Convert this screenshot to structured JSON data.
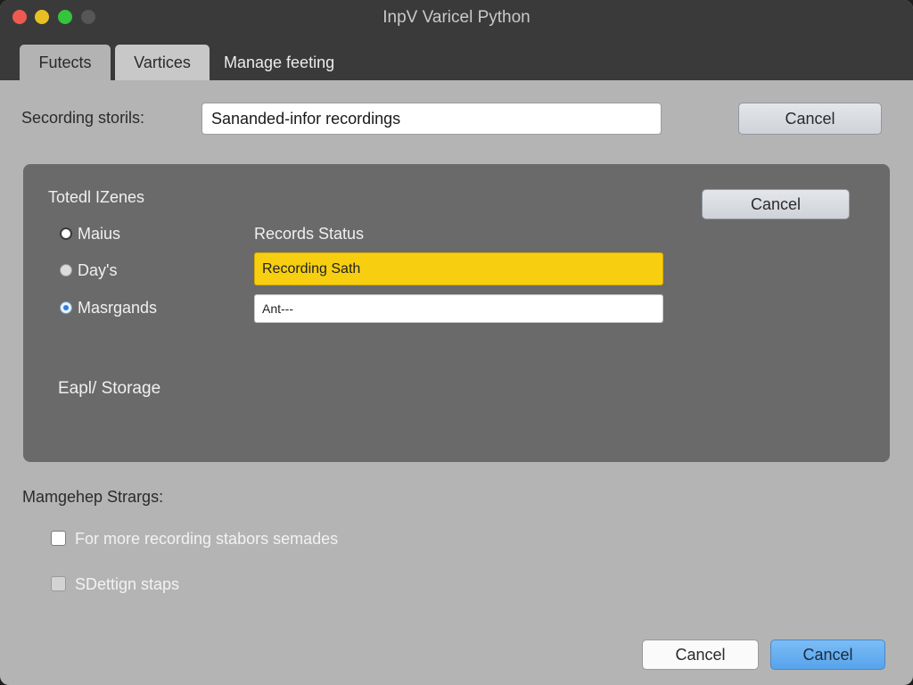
{
  "window": {
    "title": "InpV Varicel Python"
  },
  "tabs": [
    {
      "label": "Futects"
    },
    {
      "label": "Vartices"
    },
    {
      "label": "Manage feeting"
    }
  ],
  "top_row": {
    "label": "Secording storils:",
    "field_value": "Sananded-infor recordings",
    "cancel_label": "Cancel"
  },
  "panel": {
    "heading": "Totedl IZenes",
    "cancel_label": "Cancel",
    "radios": [
      {
        "label": "Maius",
        "state": "unselected"
      },
      {
        "label": "Day's",
        "state": "unselected-grey"
      },
      {
        "label": "Masrgands",
        "state": "selected"
      }
    ],
    "status_label": "Records Status",
    "status_field": "Recording Sath",
    "secondary_field": "Ant---",
    "footer_label": "Eapl/ Storage",
    "colors": {
      "highlight": "#f7cf10"
    }
  },
  "settings": {
    "heading": "Mamgehep Strargs:",
    "checkboxes": [
      {
        "label": "For more recording stabors semades",
        "checked": false
      },
      {
        "label": "SDettign staps",
        "checked": false
      }
    ]
  },
  "footer": {
    "cancel_label": "Cancel",
    "primary_label": "Cancel",
    "colors": {
      "primary": "#57a3eb"
    }
  }
}
